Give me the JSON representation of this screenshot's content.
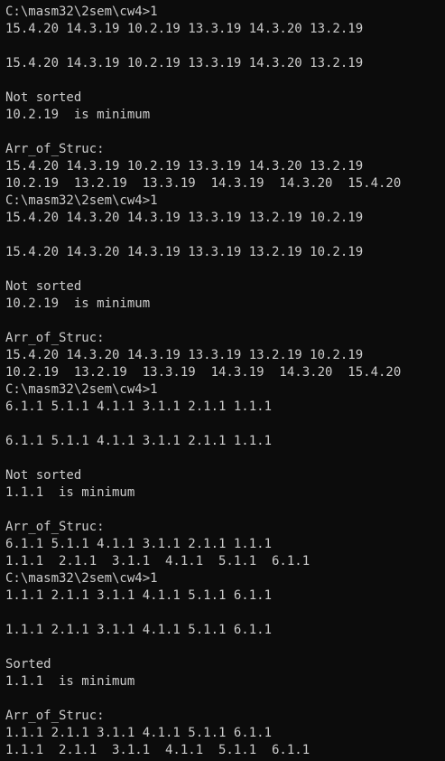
{
  "terminal": {
    "lines": [
      "C:\\masm32\\2sem\\cw4>1",
      "15.4.20 14.3.19 10.2.19 13.3.19 14.3.20 13.2.19",
      "",
      "15.4.20 14.3.19 10.2.19 13.3.19 14.3.20 13.2.19",
      "",
      "Not sorted",
      "10.2.19  is minimum",
      "",
      "Arr_of_Struc:",
      "15.4.20 14.3.19 10.2.19 13.3.19 14.3.20 13.2.19",
      "10.2.19  13.2.19  13.3.19  14.3.19  14.3.20  15.4.20",
      "C:\\masm32\\2sem\\cw4>1",
      "15.4.20 14.3.20 14.3.19 13.3.19 13.2.19 10.2.19",
      "",
      "15.4.20 14.3.20 14.3.19 13.3.19 13.2.19 10.2.19",
      "",
      "Not sorted",
      "10.2.19  is minimum",
      "",
      "Arr_of_Struc:",
      "15.4.20 14.3.20 14.3.19 13.3.19 13.2.19 10.2.19",
      "10.2.19  13.2.19  13.3.19  14.3.19  14.3.20  15.4.20",
      "C:\\masm32\\2sem\\cw4>1",
      "6.1.1 5.1.1 4.1.1 3.1.1 2.1.1 1.1.1",
      "",
      "6.1.1 5.1.1 4.1.1 3.1.1 2.1.1 1.1.1",
      "",
      "Not sorted",
      "1.1.1  is minimum",
      "",
      "Arr_of_Struc:",
      "6.1.1 5.1.1 4.1.1 3.1.1 2.1.1 1.1.1",
      "1.1.1  2.1.1  3.1.1  4.1.1  5.1.1  6.1.1",
      "C:\\masm32\\2sem\\cw4>1",
      "1.1.1 2.1.1 3.1.1 4.1.1 5.1.1 6.1.1",
      "",
      "1.1.1 2.1.1 3.1.1 4.1.1 5.1.1 6.1.1",
      "",
      "Sorted",
      "1.1.1  is minimum",
      "",
      "Arr_of_Struc:",
      "1.1.1 2.1.1 3.1.1 4.1.1 5.1.1 6.1.1",
      "1.1.1  2.1.1  3.1.1  4.1.1  5.1.1  6.1.1"
    ]
  }
}
